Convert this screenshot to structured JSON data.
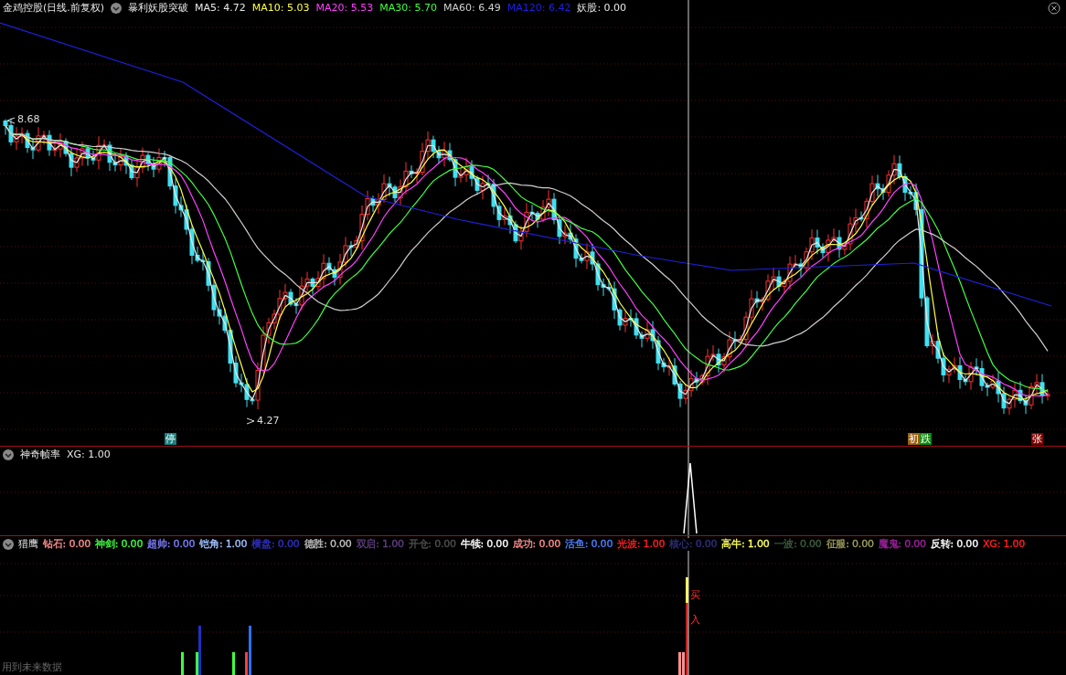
{
  "header": {
    "stock": "金鸡控股(日线.前复权)",
    "formula": "暴利妖股突破",
    "ma": [
      {
        "label": "MA5: 4.72",
        "color": "#e8e8e8"
      },
      {
        "label": "MA10: 5.03",
        "color": "#ffff40"
      },
      {
        "label": "MA20: 5.53",
        "color": "#ff40ff"
      },
      {
        "label": "MA30: 5.70",
        "color": "#40ff40"
      },
      {
        "label": "MA60: 6.49",
        "color": "#d0d0d0"
      },
      {
        "label": "MA120: 6.42",
        "color": "#2020e0"
      }
    ],
    "extra": "妖股: 0.00"
  },
  "price_chart": {
    "high_label": "8.68",
    "low_label": "4.27",
    "markers": [
      {
        "text": "停",
        "color": "#188080"
      },
      {
        "text": "初",
        "color": "#a06010"
      },
      {
        "text": "跌",
        "color": "#108a10"
      },
      {
        "text": "张",
        "color": "#800000"
      }
    ]
  },
  "panel1": {
    "title": "神奇帧率",
    "items": [
      {
        "label": "XG: 1.00"
      }
    ]
  },
  "panel2": {
    "title": "猎鹰",
    "items": [
      {
        "label": "钻石: 0.00",
        "color": "#ff9090"
      },
      {
        "label": "神剑: 0.00",
        "color": "#40ff40"
      },
      {
        "label": "超帅: 0.00",
        "color": "#8080ff"
      },
      {
        "label": "铠角: 1.00",
        "color": "#a0c0ff"
      },
      {
        "label": "横盘: 0.00",
        "color": "#3030c0"
      },
      {
        "label": "德胜: 0.00",
        "color": "#c0c0c0"
      },
      {
        "label": "双启: 1.00",
        "color": "#604080"
      },
      {
        "label": "开仓: 0.00",
        "color": "#505050"
      },
      {
        "label": "牛犊: 0.00",
        "color": "#ffffff"
      },
      {
        "label": "成功: 0.00",
        "color": "#ff9090"
      },
      {
        "label": "活鱼: 0.00",
        "color": "#5080ff"
      },
      {
        "label": "光波: 1.00",
        "color": "#ff2020"
      },
      {
        "label": "核心: 0.00",
        "color": "#303080"
      },
      {
        "label": "高牛: 1.00",
        "color": "#ffff60"
      },
      {
        "label": "一波: 0.00",
        "color": "#406040"
      },
      {
        "label": "征服: 0.00",
        "color": "#a0a060"
      },
      {
        "label": "魔鬼: 0.00",
        "color": "#a020a0"
      },
      {
        "label": "反转: 0.00",
        "color": "#ffffff"
      },
      {
        "label": "XG: 1.00",
        "color": "#ff2020"
      }
    ],
    "signal_labels": [
      "买",
      "入"
    ]
  },
  "footer_note": "用到未来数据"
}
